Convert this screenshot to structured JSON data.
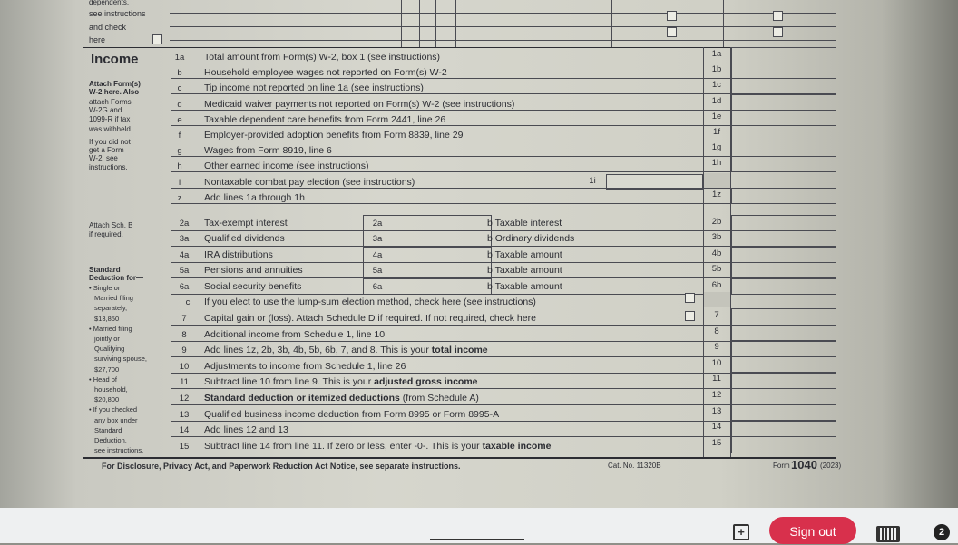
{
  "dependents_tail": {
    "line1": "dependents,",
    "line2": "see instructions",
    "line3": "and check",
    "line4": "here"
  },
  "income_section": {
    "title": "Income",
    "sidebar_notes": [
      "Attach Form(s)",
      "W-2 here. Also",
      "attach Forms",
      "W-2G and",
      "1099-R if tax",
      "was withheld.",
      "If you did not",
      "get a Form",
      "W-2, see",
      "instructions."
    ],
    "lines": [
      {
        "num": "1a",
        "label": "Total amount from Form(s) W-2, box 1 (see instructions)",
        "box": "1a"
      },
      {
        "num": "b",
        "label": "Household employee wages not reported on Form(s) W-2",
        "box": "1b"
      },
      {
        "num": "c",
        "label": "Tip income not reported on line 1a (see instructions)",
        "box": "1c"
      },
      {
        "num": "d",
        "label": "Medicaid waiver payments not reported on Form(s) W-2 (see instructions)",
        "box": "1d"
      },
      {
        "num": "e",
        "label": "Taxable dependent care benefits from Form 2441, line 26",
        "box": "1e"
      },
      {
        "num": "f",
        "label": "Employer-provided adoption benefits from Form 8839, line 29",
        "box": "1f"
      },
      {
        "num": "g",
        "label": "Wages from Form 8919, line 6",
        "box": "1g"
      },
      {
        "num": "h",
        "label": "Other earned income (see instructions)",
        "box": "1h"
      },
      {
        "num": "i",
        "label": "Nontaxable combat pay election (see instructions)",
        "box": "1i"
      },
      {
        "num": "z",
        "label": "Add lines 1a through 1h",
        "box": "1z"
      }
    ]
  },
  "sch_b_note": [
    "Attach Sch. B",
    "if required."
  ],
  "standard_deduction_note": {
    "title1": "Standard",
    "title2": "Deduction for—",
    "items": [
      "• Single or",
      "Married filing",
      "separately,",
      "$13,850",
      "• Married filing",
      "jointly or",
      "Qualifying",
      "surviving spouse,",
      "$27,700",
      "• Head of",
      "household,",
      "$20,800",
      "• If you checked",
      "any box under",
      "Standard",
      "Deduction,",
      "see instructions."
    ]
  },
  "paired_lines": [
    {
      "num": "2a",
      "label": "Tax-exempt interest",
      "box_a": "2a",
      "b_label": "b  Taxable interest",
      "box_b": "2b"
    },
    {
      "num": "3a",
      "label": "Qualified dividends",
      "box_a": "3a",
      "b_label": "b  Ordinary dividends",
      "box_b": "3b"
    },
    {
      "num": "4a",
      "label": "IRA distributions",
      "box_a": "4a",
      "b_label": "b  Taxable amount",
      "box_b": "4b"
    },
    {
      "num": "5a",
      "label": "Pensions and annuities",
      "box_a": "5a",
      "b_label": "b  Taxable amount",
      "box_b": "5b"
    },
    {
      "num": "6a",
      "label": "Social security benefits",
      "box_a": "6a",
      "b_label": "b  Taxable amount",
      "box_b": "6b"
    }
  ],
  "line_6c": {
    "num": "c",
    "label": "If you elect to use the lump-sum election method, check here (see instructions)"
  },
  "lines_7_15": [
    {
      "num": "7",
      "label": "Capital gain or (loss). Attach Schedule D if required. If not required, check here",
      "box": "7",
      "bold_part": ""
    },
    {
      "num": "8",
      "label": "Additional income from Schedule 1, line 10",
      "box": "8",
      "bold_part": ""
    },
    {
      "num": "9",
      "label": "Add lines 1z, 2b, 3b, 4b, 5b, 6b, 7, and 8. This is your ",
      "box": "9",
      "bold_part": "total income"
    },
    {
      "num": "10",
      "label": "Adjustments to income from Schedule 1, line 26",
      "box": "10",
      "bold_part": ""
    },
    {
      "num": "11",
      "label": "Subtract line 10 from line 9. This is your ",
      "box": "11",
      "bold_part": "adjusted gross income"
    },
    {
      "num": "12",
      "label": "",
      "box": "12",
      "bold_part": "Standard deduction or itemized deductions",
      "suffix": " (from Schedule A)"
    },
    {
      "num": "13",
      "label": "Qualified business income deduction from Form 8995 or Form 8995-A",
      "box": "13",
      "bold_part": ""
    },
    {
      "num": "14",
      "label": "Add lines 12 and 13",
      "box": "14",
      "bold_part": ""
    },
    {
      "num": "15",
      "label": "Subtract line 14 from line 11. If zero or less, enter -0-. This is your ",
      "box": "15",
      "bold_part": "taxable income"
    }
  ],
  "footer": {
    "notice": "For Disclosure, Privacy Act, and Paperwork Reduction Act Notice, see separate instructions.",
    "cat_no": "Cat. No. 11320B",
    "form_label": "Form",
    "form_number": "1040",
    "year": "(2023)"
  },
  "taskbar": {
    "sign_out_label": "Sign out",
    "badge_count": "2",
    "accent_color": "#d8304c"
  }
}
